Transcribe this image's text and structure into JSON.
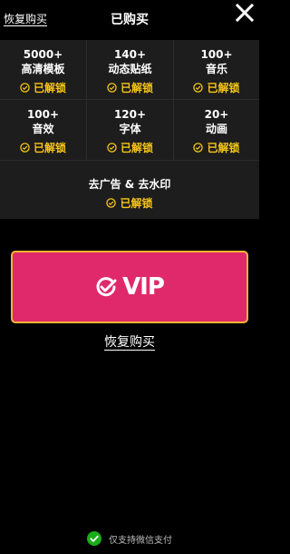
{
  "header": {
    "restore_label": "恢复购买",
    "title": "已购买",
    "close_icon": "close-icon"
  },
  "features": [
    {
      "count": "5000+",
      "name": "高清模板",
      "status": "已解锁"
    },
    {
      "count": "140+",
      "name": "动态贴纸",
      "status": "已解锁"
    },
    {
      "count": "100+",
      "name": "音乐",
      "status": "已解锁"
    },
    {
      "count": "100+",
      "name": "音效",
      "status": "已解锁"
    },
    {
      "count": "120+",
      "name": "字体",
      "status": "已解锁"
    },
    {
      "count": "20+",
      "name": "动画",
      "status": "已解锁"
    }
  ],
  "ads_feature": {
    "name": "去广告 & 去水印",
    "status": "已解锁"
  },
  "vip_button": {
    "label": "VIP",
    "icon": "check-circle-icon"
  },
  "restore_bottom_label": "恢复购买",
  "payment": {
    "icon": "wechat-check-icon",
    "text": "仅支持微信支付"
  },
  "colors": {
    "background": "#000000",
    "panel": "#1d1d1d",
    "accent_yellow": "#f5c518",
    "vip_pink": "#e0296b",
    "vip_border": "#f0b431",
    "wechat_green": "#1aad19"
  }
}
